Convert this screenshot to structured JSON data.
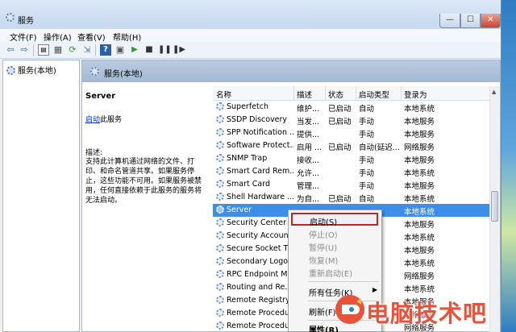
{
  "window": {
    "title": "服务",
    "min": "—",
    "max": "☐",
    "close": "✕"
  },
  "menubar": [
    "文件(F)",
    "操作(A)",
    "查看(V)",
    "帮助(H)"
  ],
  "toolbar_icons": [
    "back-arrow-icon",
    "forward-arrow-icon",
    "show-tree-icon",
    "properties-icon",
    "refresh-icon",
    "export-icon",
    "help-icon",
    "console-icon",
    "play-icon",
    "stop-icon",
    "pause-icon",
    "restart-icon"
  ],
  "tree": {
    "root": "服务(本地)"
  },
  "content": {
    "header": "服务(本地)"
  },
  "detail": {
    "service_name": "Server",
    "start_link": "启动",
    "start_suffix": "此服务",
    "desc_label": "描述:",
    "desc_text": "支持此计算机通过网络的文件、打印、和命名管道共享。如果服务停止，这些功能不可用。如果服务被禁用，任何直接依赖于此服务的服务将无法启动。"
  },
  "columns": [
    "名称",
    "描述",
    "状态",
    "启动类型",
    "登录为"
  ],
  "rows": [
    {
      "name": "Superfetch",
      "desc": "维护...",
      "state": "已启动",
      "start": "自动",
      "login": "本地系统"
    },
    {
      "name": "SSDP Discovery",
      "desc": "当发...",
      "state": "已启动",
      "start": "手动",
      "login": "本地服务"
    },
    {
      "name": "SPP Notification ...",
      "desc": "提供...",
      "state": "",
      "start": "手动",
      "login": "本地服务"
    },
    {
      "name": "Software Protect...",
      "desc": "启用 ...",
      "state": "已启动",
      "start": "自动(延迟...",
      "login": "网络服务"
    },
    {
      "name": "SNMP Trap",
      "desc": "接收...",
      "state": "",
      "start": "手动",
      "login": "本地服务"
    },
    {
      "name": "Smart Card Rem...",
      "desc": "允许...",
      "state": "",
      "start": "手动",
      "login": "本地系统"
    },
    {
      "name": "Smart Card",
      "desc": "管理...",
      "state": "",
      "start": "手动",
      "login": "本地服务"
    },
    {
      "name": "Shell Hardware ...",
      "desc": "为自...",
      "state": "已启动",
      "start": "自动",
      "login": "本地系统"
    },
    {
      "name": "Server",
      "desc": "",
      "state": "",
      "start": "",
      "login": "本地系统",
      "selected": true
    },
    {
      "name": "Security Center",
      "desc": "",
      "state": "",
      "start": "",
      "login": "本地服务"
    },
    {
      "name": "Security Account...",
      "desc": "",
      "state": "",
      "start": "",
      "login": "本地系统"
    },
    {
      "name": "Secure Socket T...",
      "desc": "",
      "state": "",
      "start": "",
      "login": "本地服务"
    },
    {
      "name": "Secondary Logon",
      "desc": "",
      "state": "",
      "start": "",
      "login": "本地系统"
    },
    {
      "name": "RPC Endpoint M...",
      "desc": "",
      "state": "",
      "start": "",
      "login": "网络服务"
    },
    {
      "name": "Routing and Re...",
      "desc": "",
      "state": "",
      "start": "",
      "login": "本地系统"
    },
    {
      "name": "Remote Registry",
      "desc": "",
      "state": "",
      "start": "",
      "login": "本地服务"
    },
    {
      "name": "Remote Procedu...",
      "desc": "",
      "state": "",
      "start": "",
      "login": "网络服务"
    },
    {
      "name": "Remote Procedu...",
      "desc": "",
      "state": "",
      "start": "",
      "login": "网络服务"
    }
  ],
  "context_menu": {
    "start": "启动(S)",
    "stop": "停止(O)",
    "pause": "暂停(U)",
    "resume": "恢复(M)",
    "restart": "重新启动(E)",
    "all_tasks": "所有任务(K)",
    "refresh": "刷新(F)",
    "properties": "属性(R)"
  },
  "watermark": {
    "text": "电脑技术吧"
  }
}
